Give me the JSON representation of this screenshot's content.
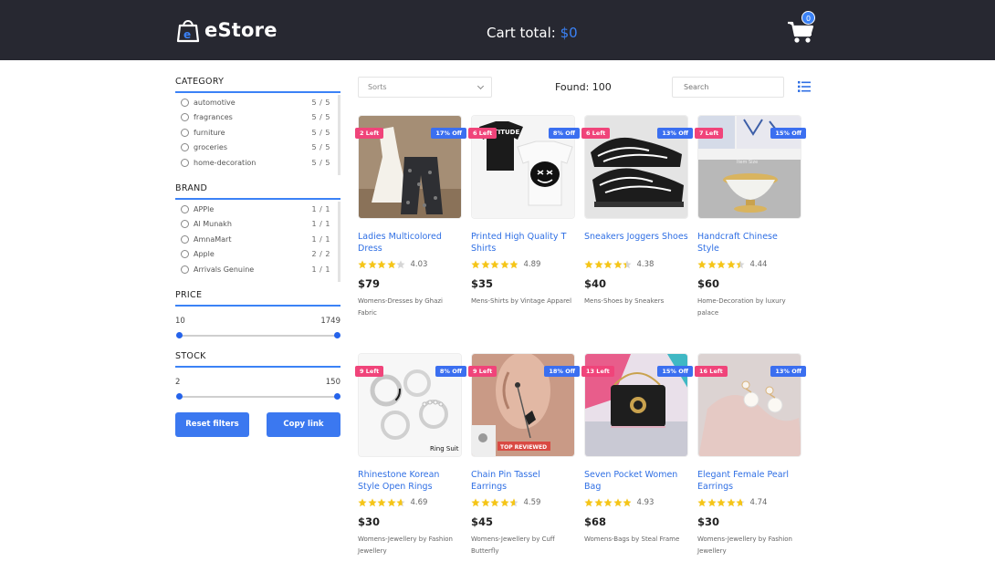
{
  "header": {
    "brand": "eStore",
    "cart_total_label": "Cart total:",
    "cart_total_amount": "$0",
    "cart_count": "0"
  },
  "sidebar": {
    "category": {
      "title": "CATEGORY",
      "items": [
        {
          "label": "automotive",
          "count": "5 / 5"
        },
        {
          "label": "fragrances",
          "count": "5 / 5"
        },
        {
          "label": "furniture",
          "count": "5 / 5"
        },
        {
          "label": "groceries",
          "count": "5 / 5"
        },
        {
          "label": "home-decoration",
          "count": "5 / 5"
        }
      ]
    },
    "brand": {
      "title": "BRAND",
      "items": [
        {
          "label": "APPle",
          "count": "1 / 1"
        },
        {
          "label": "Al Munakh",
          "count": "1 / 1"
        },
        {
          "label": "AmnaMart",
          "count": "1 / 1"
        },
        {
          "label": "Apple",
          "count": "2 / 2"
        },
        {
          "label": "Arrivals Genuine",
          "count": "1 / 1"
        }
      ]
    },
    "price": {
      "title": "PRICE",
      "min": "10",
      "max": "1749"
    },
    "stock": {
      "title": "STOCK",
      "min": "2",
      "max": "150"
    },
    "reset_label": "Reset filters",
    "copy_label": "Copy link"
  },
  "toolbar": {
    "sort_placeholder": "Sorts",
    "found": "Found: 100",
    "search_placeholder": "Search"
  },
  "products": [
    {
      "title": "Ladies Multicolored Dress",
      "left": "2 Left",
      "off": "17% Off",
      "rating": "4.03",
      "stars": 4.03,
      "price": "$79",
      "meta": "Womens-Dresses by Ghazi Fabric",
      "img": "dress-icon"
    },
    {
      "title": "Printed High Quality T Shirts",
      "left": "6 Left",
      "off": "8% Off",
      "rating": "4.89",
      "stars": 4.89,
      "price": "$35",
      "meta": "Mens-Shirts by Vintage Apparel",
      "img": "tshirt-icon",
      "img_text": "ATTITUDE"
    },
    {
      "title": "Sneakers Joggers Shoes",
      "left": "6 Left",
      "off": "13% Off",
      "rating": "4.38",
      "stars": 4.38,
      "price": "$40",
      "meta": "Mens-Shoes by Sneakers",
      "img": "shoe-icon"
    },
    {
      "title": "Handcraft Chinese Style",
      "left": "7 Left",
      "off": "15% Off",
      "rating": "4.44",
      "stars": 4.44,
      "price": "$60",
      "meta": "Home-Decoration by luxury palace",
      "img": "vase-icon",
      "img_text": "Item Size"
    },
    {
      "title": "Rhinestone Korean Style Open Rings",
      "left": "9 Left",
      "off": "8% Off",
      "rating": "4.69",
      "stars": 4.69,
      "price": "$30",
      "meta": "Womens-Jewellery by Fashion Jewellery",
      "img": "ring-icon",
      "img_text": "Ring Suit"
    },
    {
      "title": "Chain Pin Tassel Earrings",
      "left": "9 Left",
      "off": "18% Off",
      "rating": "4.59",
      "stars": 4.59,
      "price": "$45",
      "meta": "Womens-Jewellery by Cuff Butterfly",
      "img": "earring-icon",
      "img_text": "TOP REVIEWED"
    },
    {
      "title": "Seven Pocket Women Bag",
      "left": "13 Left",
      "off": "15% Off",
      "rating": "4.93",
      "stars": 4.93,
      "price": "$68",
      "meta": "Womens-Bags by Steal Frame",
      "img": "bag-icon"
    },
    {
      "title": "Elegant Female Pearl Earrings",
      "left": "16 Left",
      "off": "13% Off",
      "rating": "4.74",
      "stars": 4.74,
      "price": "$30",
      "meta": "Womens-Jewellery by Fashion Jewellery",
      "img": "pearl-icon"
    }
  ],
  "colors": {
    "accent": "#3b82f6",
    "header_bg": "#272831",
    "left_tag": "#f0447a",
    "off_tag": "#3b6ff0",
    "star": "#f5c518"
  }
}
